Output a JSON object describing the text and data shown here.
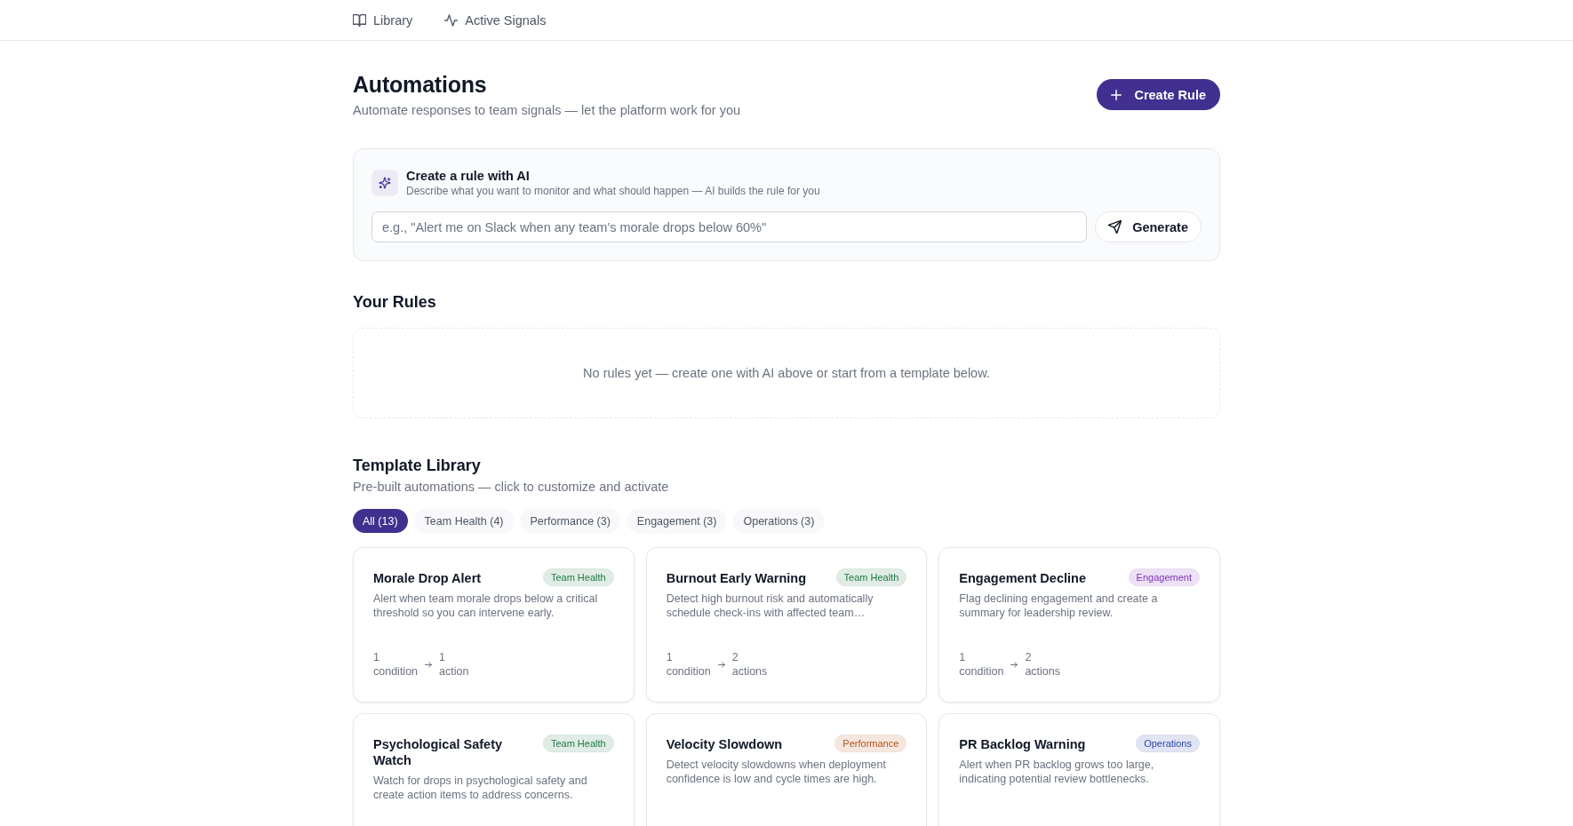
{
  "nav": [
    {
      "label": "Library"
    },
    {
      "label": "Active Signals"
    }
  ],
  "header": {
    "title": "Automations",
    "subtitle": "Automate responses to team signals — let the platform work for you",
    "create_button": "Create Rule"
  },
  "ai_card": {
    "title": "Create a rule with AI",
    "description": "Describe what you want to monitor and what should happen — AI builds the rule for you",
    "input": {
      "placeholder": "e.g., \"Alert me on Slack when any team's morale drops below 60%\""
    },
    "generate_button": "Generate"
  },
  "rules": {
    "title": "Your Rules",
    "empty_message": "No rules yet — create one with AI above or start from a template below."
  },
  "templates": {
    "title": "Template Library",
    "subtitle": "Pre-built automations — click to customize and activate",
    "filters": [
      {
        "label": "All (13)",
        "selected": true
      },
      {
        "label": "Team Health (4)",
        "selected": false
      },
      {
        "label": "Performance (3)",
        "selected": false
      },
      {
        "label": "Engagement (3)",
        "selected": false
      },
      {
        "label": "Operations (3)",
        "selected": false
      }
    ],
    "cards": [
      {
        "title": "Morale Drop Alert",
        "tag": "Team Health",
        "color": "#1f7a45",
        "description": "Alert when team morale drops below a critical threshold so you can intervene early.",
        "condition_count": "1",
        "condition_label": "condition",
        "action_count": "1",
        "action_label": "action"
      },
      {
        "title": "Burnout Early Warning",
        "tag": "Team Health",
        "color": "#1f7a45",
        "description": "Detect high burnout risk and automatically schedule check-ins with affected team…",
        "condition_count": "1",
        "condition_label": "condition",
        "action_count": "2",
        "action_label": "actions"
      },
      {
        "title": "Engagement Decline",
        "tag": "Engagement",
        "color": "#7b2fb8",
        "description": "Flag declining engagement and create a summary for leadership review.",
        "condition_count": "1",
        "condition_label": "condition",
        "action_count": "2",
        "action_label": "actions"
      },
      {
        "title": "Psychological Safety Watch",
        "tag": "Team Health",
        "color": "#1f7a45",
        "description": "Watch for drops in psychological safety and create action items to address concerns."
      },
      {
        "title": "Velocity Slowdown",
        "tag": "Performance",
        "color": "#b4531a",
        "description": "Detect velocity slowdowns when deployment confidence is low and cycle times are high."
      },
      {
        "title": "PR Backlog Warning",
        "tag": "Operations",
        "color": "#2b46a8",
        "description": "Alert when PR backlog grows too large, indicating potential review bottlenecks."
      }
    ]
  }
}
